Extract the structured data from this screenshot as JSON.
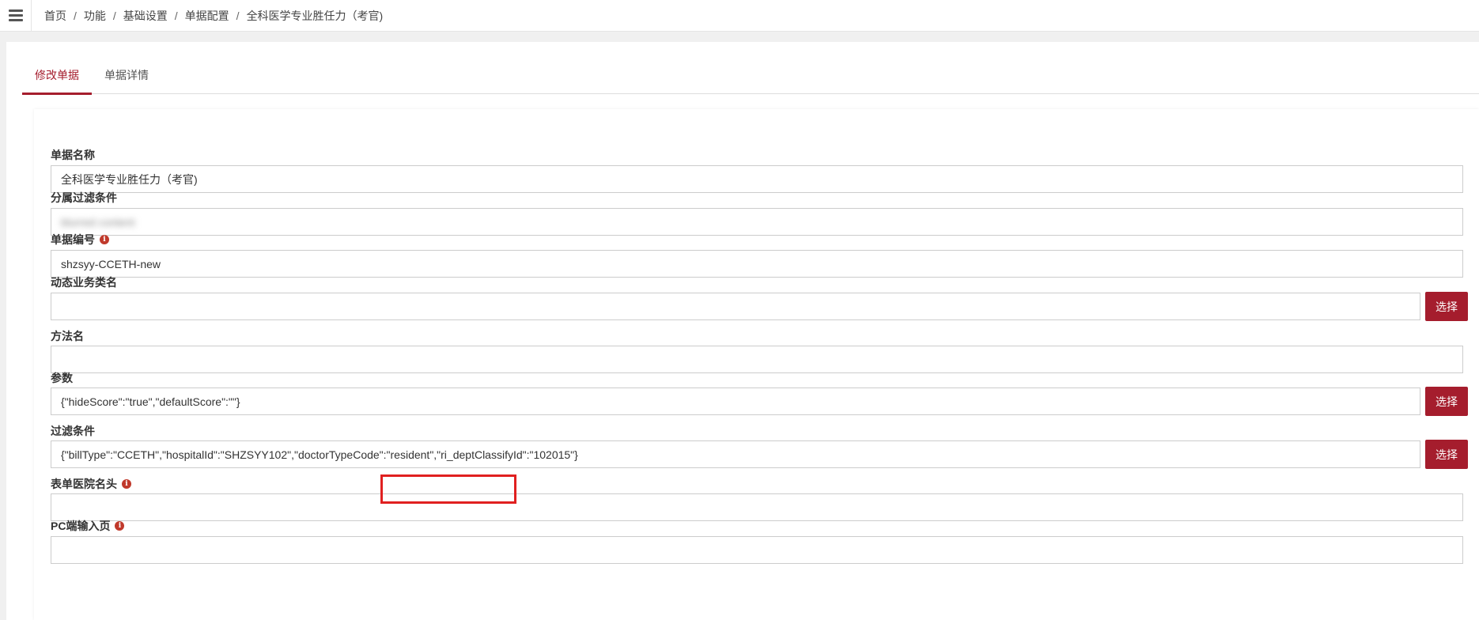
{
  "breadcrumb": [
    "首页",
    "功能",
    "基础设置",
    "单据配置",
    "全科医学专业胜任力（考官)"
  ],
  "breadcrumb_sep": "/",
  "tabs": [
    {
      "label": "修改单据",
      "active": true
    },
    {
      "label": "单据详情",
      "active": false
    }
  ],
  "fields": {
    "bill_name": {
      "label": "单据名称",
      "value": "全科医学专业胜任力（考官)"
    },
    "filter_attr": {
      "label": "分属过滤条件",
      "value": "blurred content"
    },
    "bill_code": {
      "label": "单据编号",
      "value": "shzsyy-CCETH-new"
    },
    "dynamic_class": {
      "label": "动态业务类名",
      "value": ""
    },
    "method_name": {
      "label": "方法名",
      "value": ""
    },
    "params": {
      "label": "参数",
      "value": "{\"hideScore\":\"true\",\"defaultScore\":\"\"}"
    },
    "filter_cond": {
      "label": "过滤条件",
      "value": "{\"billType\":\"CCETH\",\"hospitalId\":\"SHZSYY102\",\"doctorTypeCode\":\"resident\",\"ri_deptClassifyId\":\"102015\"}"
    },
    "form_header": {
      "label": "表单医院名头",
      "value": ""
    },
    "pc_input_page": {
      "label": "PC端输入页",
      "value": ""
    }
  },
  "select_button_label": "选择",
  "info_icon_glyph": "i",
  "colors": {
    "accent": "#a51d2d",
    "highlight": "#e02020"
  }
}
